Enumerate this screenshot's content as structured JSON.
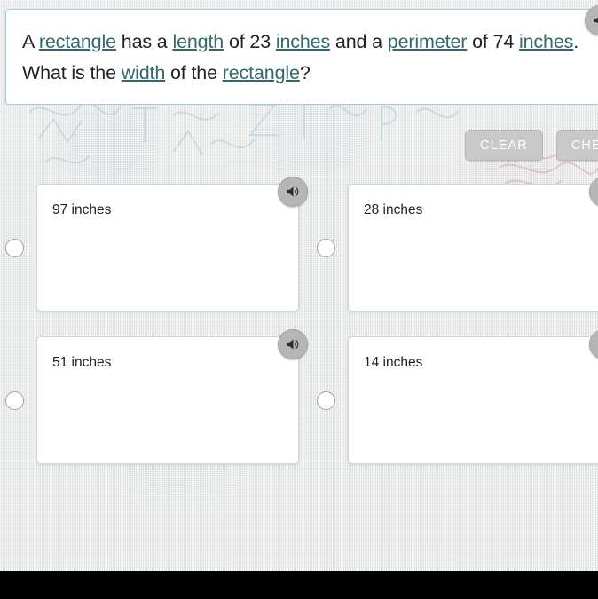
{
  "question": {
    "segments": [
      {
        "text": "A ",
        "gloss": false
      },
      {
        "text": "rectangle",
        "gloss": true
      },
      {
        "text": " has a ",
        "gloss": false
      },
      {
        "text": "length",
        "gloss": true
      },
      {
        "text": " of 23 ",
        "gloss": false
      },
      {
        "text": "inches",
        "gloss": true
      },
      {
        "text": " and a ",
        "gloss": false
      },
      {
        "text": "perimeter",
        "gloss": true
      },
      {
        "text": " of 74 ",
        "gloss": false
      },
      {
        "text": "inches",
        "gloss": true
      },
      {
        "text": ". What is the ",
        "gloss": false
      },
      {
        "text": "width",
        "gloss": true
      },
      {
        "text": " of the ",
        "gloss": false
      },
      {
        "text": "rectangle",
        "gloss": true
      },
      {
        "text": "?",
        "gloss": false
      }
    ],
    "plain_text": "A rectangle has a length of 23 inches and a perimeter of 74 inches. What is the width of the rectangle?",
    "speaker_icon": "speaker-icon"
  },
  "actions": {
    "clear_label": "CLEAR",
    "check_label": "CHECK"
  },
  "options": [
    {
      "label": "97 inches",
      "selected": false,
      "speaker_icon": "speaker-icon"
    },
    {
      "label": "28 inches",
      "selected": false,
      "speaker_icon": "speaker-icon"
    },
    {
      "label": "51 inches",
      "selected": false,
      "speaker_icon": "speaker-icon"
    },
    {
      "label": "14 inches",
      "selected": false,
      "speaker_icon": "speaker-icon"
    }
  ],
  "colors": {
    "gloss_link": "#33686c",
    "question_border": "#9fd2d8",
    "button_fill": "#c9c9c9",
    "speaker_fill": "#b6b6b6",
    "card_background": "#ffffff",
    "page_background": "#e8e9e9",
    "bottom_bar": "#000000"
  }
}
